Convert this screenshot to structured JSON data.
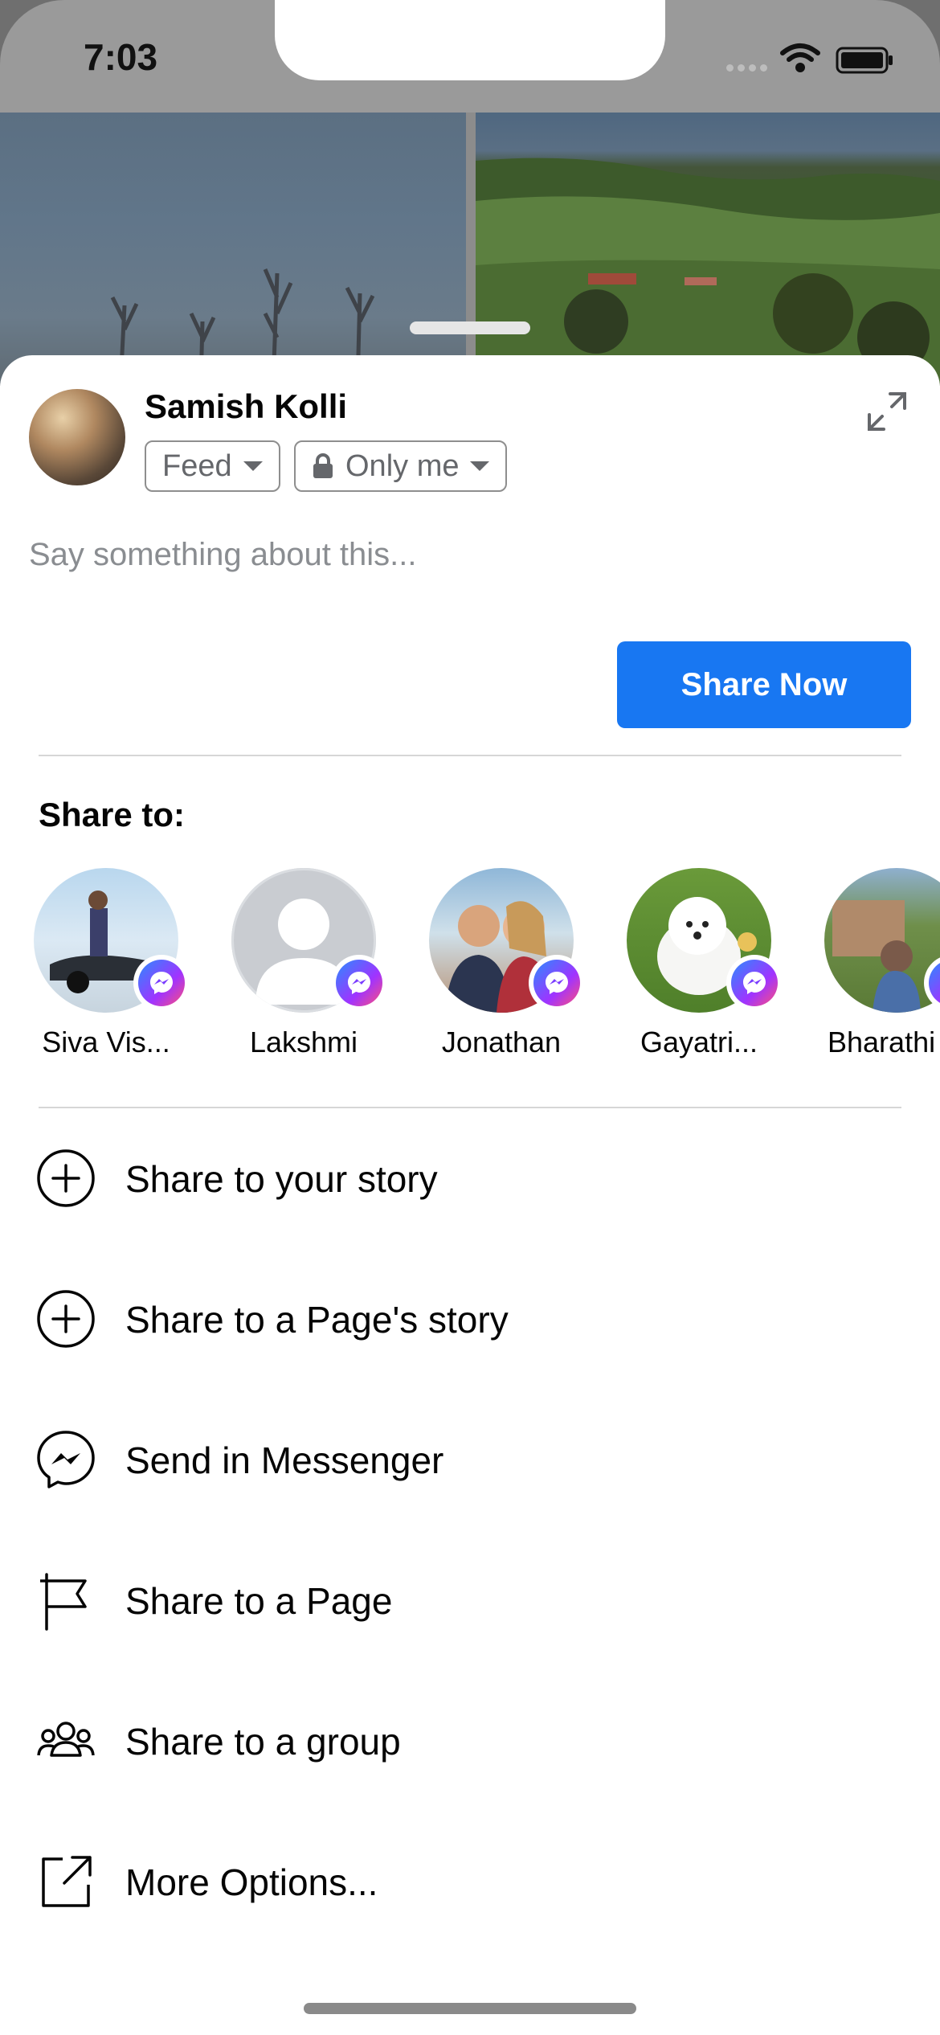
{
  "status_bar": {
    "time": "7:03"
  },
  "composer": {
    "user_name": "Samish Kolli",
    "audience_feed": "Feed",
    "privacy": "Only me",
    "placeholder": "Say something about this...",
    "share_button": "Share Now"
  },
  "share_to": {
    "heading": "Share to:",
    "contacts": [
      {
        "name": "Siva Vis..."
      },
      {
        "name": "Lakshmi"
      },
      {
        "name": "Jonathan"
      },
      {
        "name": "Gayatri..."
      },
      {
        "name": "Bharathi"
      }
    ]
  },
  "options": [
    {
      "label": "Share to your story",
      "icon": "plus-circle-icon"
    },
    {
      "label": "Share to a Page's story",
      "icon": "plus-circle-icon"
    },
    {
      "label": "Send in Messenger",
      "icon": "messenger-icon"
    },
    {
      "label": "Share to a Page",
      "icon": "flag-icon"
    },
    {
      "label": "Share to a group",
      "icon": "group-icon"
    },
    {
      "label": "More Options...",
      "icon": "external-link-icon"
    }
  ],
  "colors": {
    "primary": "#1877f2",
    "secondary_text": "#65676b",
    "divider": "#d6d6d6"
  }
}
